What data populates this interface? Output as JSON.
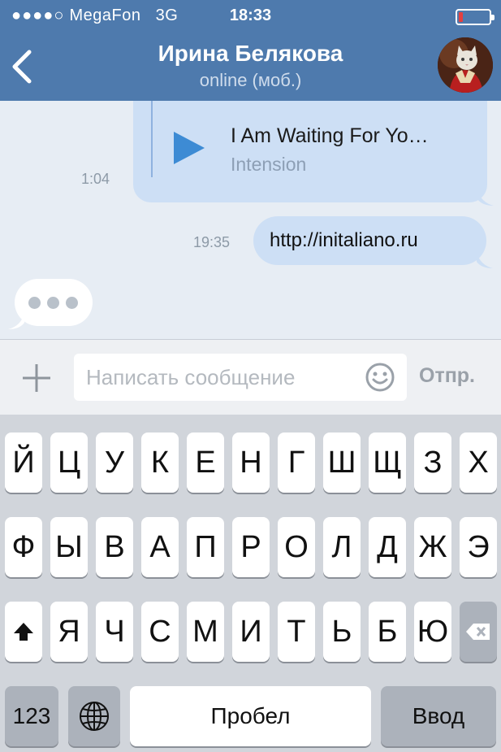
{
  "status_bar": {
    "signal": "●●●●○",
    "carrier": "MegaFon",
    "network": "3G",
    "time": "18:33"
  },
  "header": {
    "title": "Ирина Белякова",
    "subtitle": "online (моб.)",
    "back_icon": "chevron-left-icon",
    "avatar_icon": "avatar"
  },
  "messages": [
    {
      "type": "audio",
      "time": "1:04",
      "track_title": "I Am Waiting For Yo…",
      "artist": "Intension"
    },
    {
      "type": "text",
      "time": "19:35",
      "text": "http://initaliano.ru"
    }
  ],
  "composer": {
    "placeholder": "Написать сообщение",
    "send_label": "Отпр.",
    "attach_icon": "plus-icon",
    "emoji_icon": "smile-icon"
  },
  "keyboard": {
    "rows": [
      [
        "Й",
        "Ц",
        "У",
        "К",
        "Е",
        "Н",
        "Г",
        "Ш",
        "Щ",
        "З",
        "Х"
      ],
      [
        "Ф",
        "Ы",
        "В",
        "А",
        "П",
        "Р",
        "О",
        "Л",
        "Д",
        "Ж",
        "Э"
      ],
      [
        "Я",
        "Ч",
        "С",
        "М",
        "И",
        "Т",
        "Ь",
        "Б",
        "Ю"
      ]
    ],
    "numbers_label": "123",
    "space_label": "Пробел",
    "return_label": "Ввод",
    "shift_icon": "shift-icon",
    "delete_icon": "backspace-icon",
    "globe_icon": "globe-icon"
  },
  "colors": {
    "header": "#4e7aad",
    "bubble_out": "#cddff5",
    "chat_bg": "#e7edf4",
    "accent": "#3d8bd4"
  }
}
